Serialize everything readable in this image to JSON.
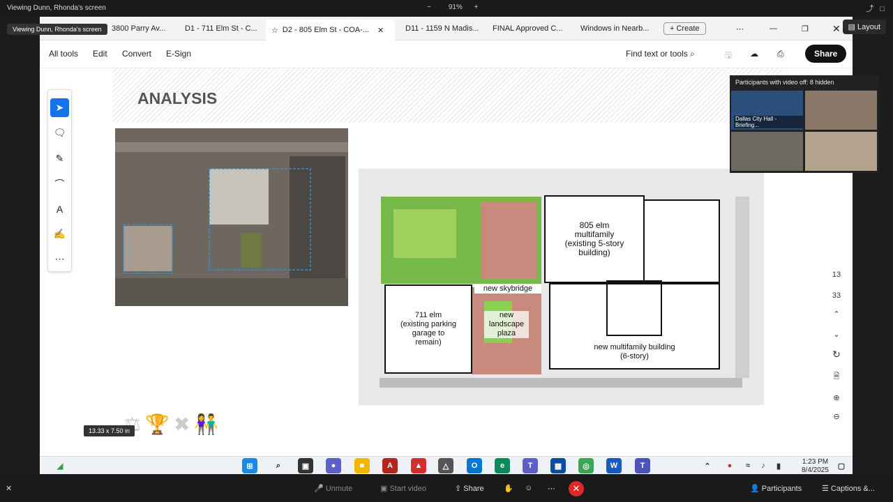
{
  "zoom": {
    "viewing_text": "Viewing Dunn, Rhonda's screen",
    "badge_text": "Viewing Dunn, Rhonda's screen",
    "zoom_controls": {
      "minus": "−",
      "level": "91%",
      "plus": "+"
    },
    "layout_label": "Layout",
    "bottom": {
      "unmute": "Unmute",
      "start_video": "Start video",
      "share": "Share",
      "participants": "Participants",
      "captions": "Captions &..."
    },
    "video_panel": {
      "header": "Participants with video off: 8 hidden",
      "tiles": [
        {
          "name": "Dallas City Hall - Briefing..."
        },
        {
          "name": ""
        },
        {
          "name": ""
        },
        {
          "name": ""
        }
      ]
    }
  },
  "browser": {
    "tabs": [
      {
        "label": "3800 Parry Av..."
      },
      {
        "label": "D1 - 711 Elm St - C..."
      },
      {
        "label": "D2 - 805 Elm St - COA-...",
        "active": true
      },
      {
        "label": "D11 - 1159 N Madis..."
      },
      {
        "label": "FINAL Approved C..."
      },
      {
        "label": "Windows in Nearb..."
      }
    ],
    "create_label": "Create",
    "more": "⋯"
  },
  "acrobat": {
    "menu": [
      "All tools",
      "Edit",
      "Convert",
      "E-Sign"
    ],
    "find_label": "Find text or tools",
    "share_label": "Share",
    "page_current": "13",
    "page_total": "33",
    "size_label": "13.33 x 7.50 in"
  },
  "slide": {
    "title": "ANALYSIS",
    "plan_labels": {
      "elm805": "805 elm\nmultifamily\n(existing 5-story\nbuilding)",
      "elm711": "711 elm\n(existing parking\ngarage to\nremain)",
      "skybridge": "new skybridge",
      "landscape": "new\nlandscape\nplaza",
      "newmf": "new multifamily building\n(6-story)"
    }
  },
  "taskbar": {
    "time": "1:23 PM",
    "date": "8/4/2025"
  }
}
